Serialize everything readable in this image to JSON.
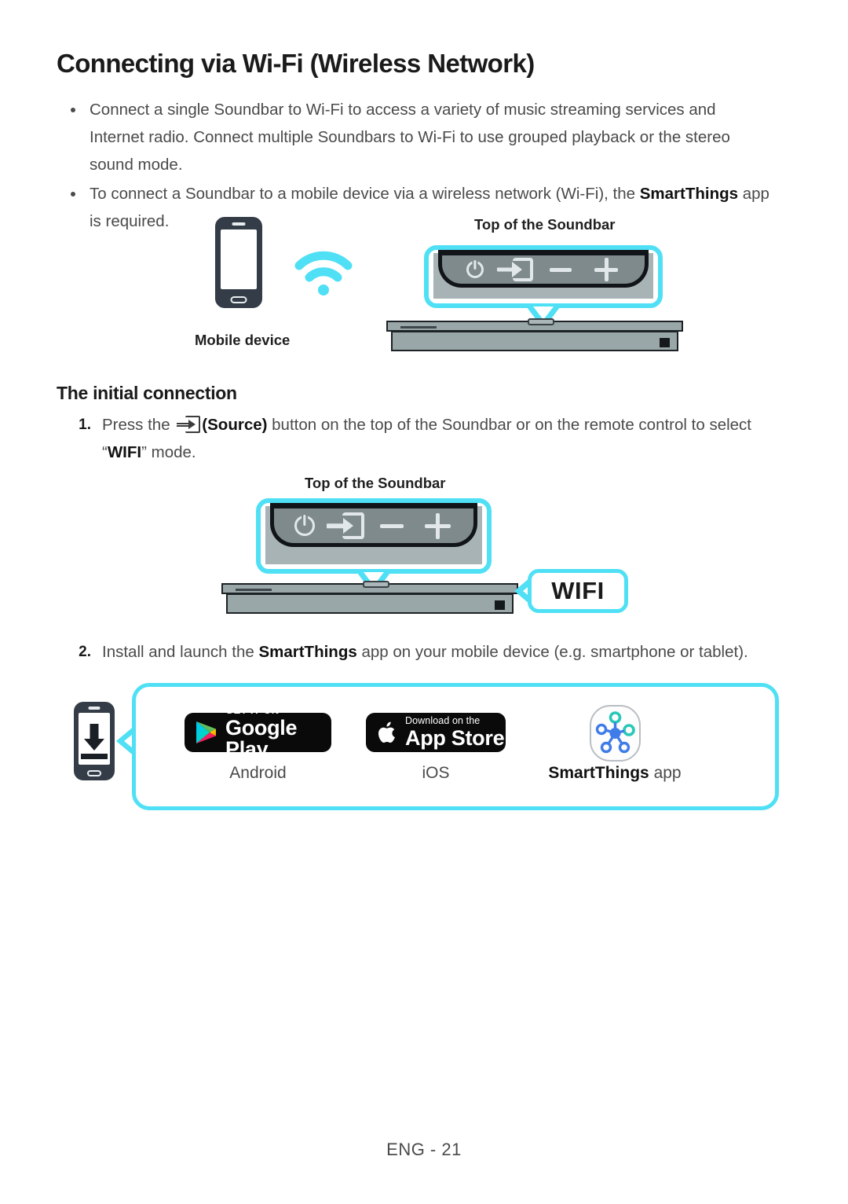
{
  "page": {
    "title": "Connecting via Wi-Fi (Wireless Network)",
    "footer": "ENG - 21",
    "accent_color": "#4fe0f5",
    "text_color": "#4a4a4a"
  },
  "bullets": [
    {
      "text_before": "Connect a single Soundbar to Wi-Fi to access a variety of music streaming services and Internet radio. Connect multiple Soundbars to Wi-Fi to use grouped playback or the stereo sound mode."
    },
    {
      "text_before": "To connect a Soundbar to a mobile device via a wireless network (Wi-Fi), the ",
      "bold": "SmartThings",
      "text_after": " app is required."
    }
  ],
  "diagram1": {
    "mobile_label": "Mobile device",
    "soundbar_label": "Top of the Soundbar",
    "panel_buttons": [
      "power-icon",
      "source-icon",
      "volume-down-icon",
      "volume-up-icon"
    ],
    "wifi_icon": "wifi-signal-icon"
  },
  "section": {
    "subtitle": "The initial connection"
  },
  "steps": [
    {
      "num": "1.",
      "text_before": "Press the ",
      "icon": "source-icon",
      "bold1": "(Source)",
      "text_mid": " button on the top of the Soundbar or on the remote control to select “",
      "bold2": "WIFI",
      "text_after": "” mode."
    },
    {
      "num": "2.",
      "text_before": "Install and launch the ",
      "bold1": "SmartThings",
      "text_after": " app on your mobile device (e.g. smartphone or tablet)."
    }
  ],
  "diagram2": {
    "soundbar_label": "Top of the Soundbar",
    "callout": "WIFI",
    "panel_buttons": [
      "power-icon",
      "source-icon",
      "volume-down-icon",
      "volume-up-icon"
    ]
  },
  "app_panel": {
    "phone_icon": "download-phone-icon",
    "items": [
      {
        "badge_small": "GET IT ON",
        "badge_big": "Google Play",
        "badge_icon": "google-play-icon",
        "label": "Android",
        "label_bold": ""
      },
      {
        "badge_small": "Download on the",
        "badge_big": "App Store",
        "badge_icon": "apple-icon",
        "label": "iOS",
        "label_bold": ""
      },
      {
        "badge_icon": "smartthings-icon",
        "label_bold": "SmartThings",
        "label": " app"
      }
    ]
  }
}
